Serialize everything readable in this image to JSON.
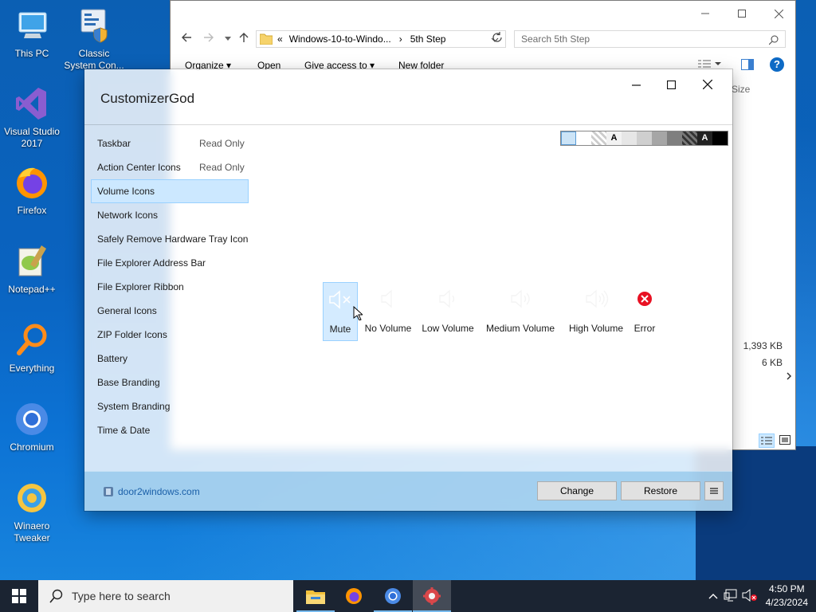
{
  "desktop": {
    "icons": [
      {
        "label": "This PC"
      },
      {
        "label": "Classic System Con..."
      },
      {
        "label": "Visual Studio 2017"
      },
      {
        "label": "Firefox"
      },
      {
        "label": "Notepad++"
      },
      {
        "label": "Everything"
      },
      {
        "label": "Chromium"
      },
      {
        "label": "Winaero Tweaker"
      }
    ]
  },
  "explorer": {
    "address_parts": [
      "«",
      "Windows-10-to-Windo...",
      "›",
      "5th Step"
    ],
    "search_placeholder": "Search 5th Step",
    "commands": [
      "Organize ▾",
      "Open",
      "Give access to ▾",
      "New folder"
    ],
    "size_header": "Size",
    "visible_sizes": [
      "1,393 KB",
      "6 KB"
    ]
  },
  "customizer": {
    "title": "CustomizerGod",
    "items": [
      {
        "label": "Taskbar",
        "note": "Read Only"
      },
      {
        "label": "Action Center Icons",
        "note": "Read Only"
      },
      {
        "label": "Volume Icons",
        "note": ""
      },
      {
        "label": "Network Icons",
        "note": ""
      },
      {
        "label": "Safely Remove Hardware Tray Icon",
        "note": ""
      },
      {
        "label": "File Explorer Address Bar",
        "note": ""
      },
      {
        "label": "File Explorer Ribbon",
        "note": ""
      },
      {
        "label": "General Icons",
        "note": ""
      },
      {
        "label": "ZIP Folder Icons",
        "note": ""
      },
      {
        "label": "Battery",
        "note": ""
      },
      {
        "label": "Base Branding",
        "note": ""
      },
      {
        "label": "System Branding",
        "note": ""
      },
      {
        "label": "Time & Date",
        "note": ""
      }
    ],
    "selected_item": "Volume Icons",
    "swatch_letter": "A",
    "volume_icons": [
      {
        "label": "Mute"
      },
      {
        "label": "No Volume"
      },
      {
        "label": "Low Volume"
      },
      {
        "label": "Medium Volume"
      },
      {
        "label": "High Volume"
      },
      {
        "label": "Error"
      }
    ],
    "link": "door2windows.com",
    "buttons": {
      "change": "Change",
      "restore": "Restore"
    }
  },
  "taskbar": {
    "search_placeholder": "Type here to search",
    "time": "4:50 PM",
    "date": "4/23/2024"
  },
  "colors": {
    "accent": "#0078d7",
    "selection": "#cce8ff",
    "error": "#e81123"
  }
}
